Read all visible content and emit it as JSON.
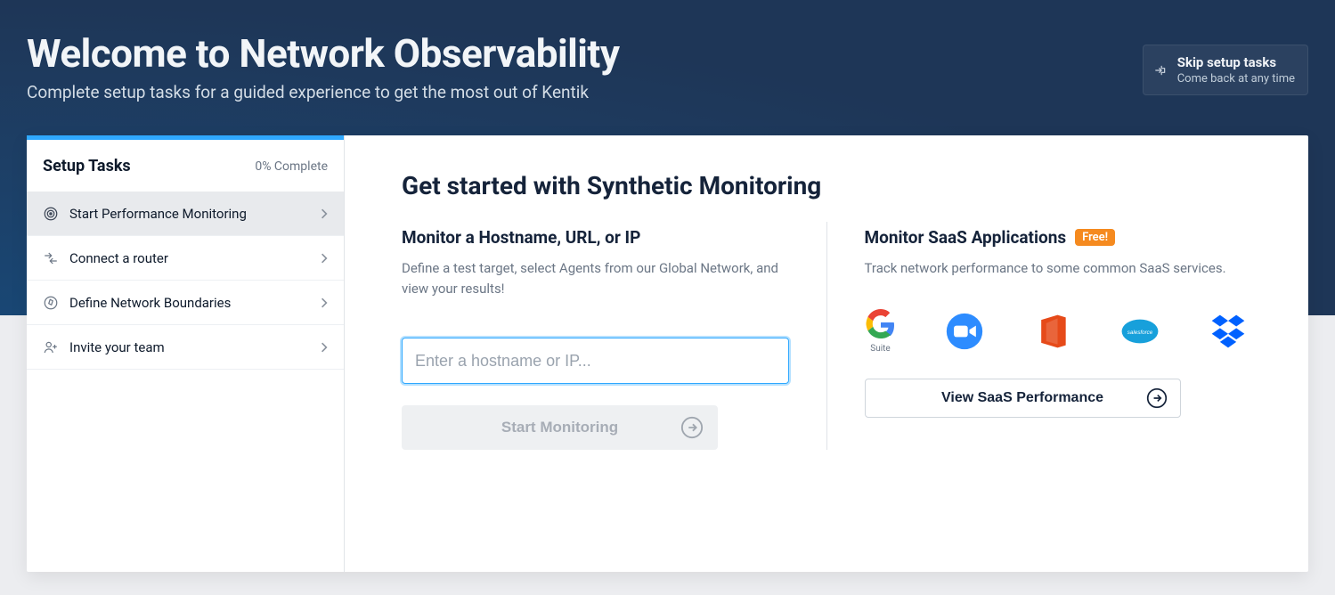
{
  "hero": {
    "title": "Welcome to Network Observability",
    "subtitle": "Complete setup tasks for a guided experience to get the most out of Kentik"
  },
  "skip": {
    "title": "Skip setup tasks",
    "subtitle": "Come back at any time"
  },
  "sidebar": {
    "title": "Setup Tasks",
    "progress": "0% Complete",
    "items": [
      {
        "label": "Start Performance Monitoring",
        "icon": "target-icon",
        "active": true
      },
      {
        "label": "Connect a router",
        "icon": "router-icon",
        "active": false
      },
      {
        "label": "Define Network Boundaries",
        "icon": "compass-icon",
        "active": false
      },
      {
        "label": "Invite your team",
        "icon": "add-user-icon",
        "active": false
      }
    ]
  },
  "panel": {
    "title": "Get started with Synthetic Monitoring",
    "hostname": {
      "heading": "Monitor a Hostname, URL, or IP",
      "desc": "Define a test target, select Agents from our Global Network, and view your results!",
      "placeholder": "Enter a hostname or IP...",
      "value": "",
      "button": "Start Monitoring"
    },
    "saas": {
      "heading": "Monitor SaaS Applications",
      "badge": "Free!",
      "desc": "Track network performance to some common SaaS services.",
      "button": "View SaaS Performance",
      "logos": [
        {
          "name": "gsuite-logo",
          "label": "Suite"
        },
        {
          "name": "zoom-logo",
          "label": ""
        },
        {
          "name": "office-logo",
          "label": ""
        },
        {
          "name": "salesforce-logo",
          "label": ""
        },
        {
          "name": "dropbox-logo",
          "label": ""
        }
      ]
    }
  },
  "colors": {
    "accent": "#2fa8ff",
    "free_badge": "#f58a1f"
  }
}
